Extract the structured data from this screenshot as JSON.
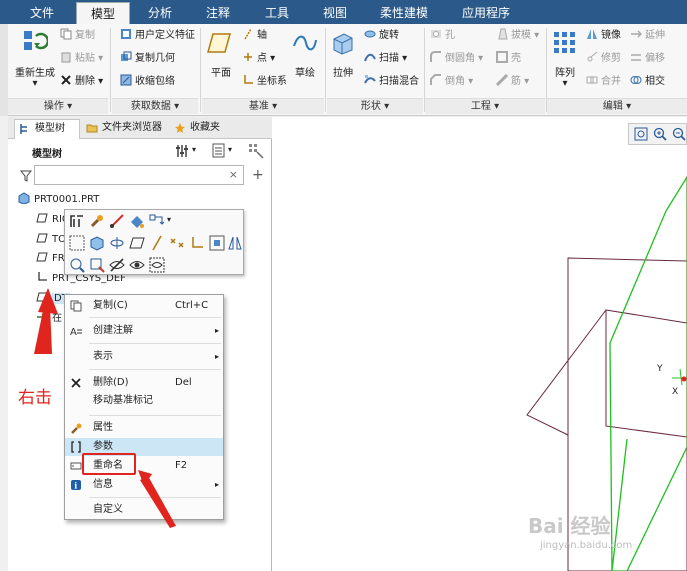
{
  "ribbon_tabs": [
    "文件",
    "模型",
    "分析",
    "注释",
    "工具",
    "视图",
    "柔性建模",
    "应用程序"
  ],
  "active_tab": "模型",
  "groups": {
    "operations": {
      "label": "操作",
      "big": "重新生成",
      "items": [
        "复制",
        "粘贴",
        "删除"
      ]
    },
    "get_data": {
      "label": "获取数据",
      "items": [
        "用户定义特征",
        "复制几何",
        "收缩包络"
      ]
    },
    "datum": {
      "label": "基准",
      "big": "平面",
      "items": [
        "轴",
        "点",
        "坐标系"
      ],
      "sketch": "草绘"
    },
    "shapes": {
      "label": "形状",
      "big": "拉伸",
      "items": [
        "旋转",
        "扫描",
        "扫描混合"
      ]
    },
    "engineering": {
      "label": "工程",
      "items": [
        "孔",
        "倒圆角",
        "倒角",
        "拔模",
        "壳",
        "筋"
      ]
    },
    "editing": {
      "label": "编辑",
      "big": "阵列",
      "items": [
        "镜像",
        "修剪",
        "合并",
        "延伸",
        "偏移",
        "相交"
      ]
    }
  },
  "panel_tabs": [
    "模型树",
    "文件夹浏览器",
    "收藏夹"
  ],
  "tree_header": "模型树",
  "tree_items": [
    "PRT0001.PRT",
    "RIG",
    "TO",
    "FRO",
    "PRT_CSYS_DEF",
    "DT",
    "在"
  ],
  "context_menu": {
    "items": [
      {
        "label": "复制(C)",
        "shortcut": "Ctrl+C"
      },
      {
        "label": "创建注解",
        "arrow": "▸"
      },
      {
        "label": "表示",
        "arrow": "▸"
      },
      {
        "label": "删除(D)",
        "shortcut": "Del"
      },
      {
        "label": "移动基准标记"
      },
      {
        "label": "属性"
      },
      {
        "label": "参数"
      },
      {
        "label": "重命名",
        "shortcut": "F2"
      },
      {
        "label": "信息",
        "arrow": "▸"
      },
      {
        "label": "自定义"
      }
    ]
  },
  "graphics": {
    "axis_y": "Y",
    "axis_x": "X"
  },
  "annotation": "右击",
  "watermark": {
    "brand": "Bai 经验",
    "url": "jingyan.baidu.com"
  },
  "colors": {
    "tabbar": "#2b5a8a",
    "highlight": "#cde6f5",
    "annotation": "#e0241e",
    "plane_green": "#1fc01f",
    "plane_maroon": "#6a2840"
  }
}
